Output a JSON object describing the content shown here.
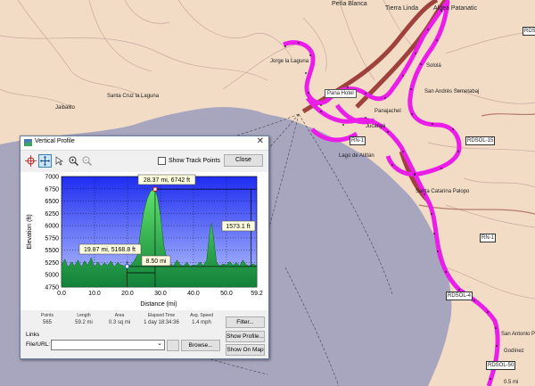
{
  "map": {
    "place_labels": [
      "Peña Blanca",
      "Tierra Linda",
      "Aldea Patanatic",
      "Jorge la Laguna",
      "Santa Cruz la Laguna",
      "Jaibalito",
      "Pana Hotel",
      "Jucanyá",
      "Lago de Atitlán",
      "Sololá",
      "San Andrés Semetabaj",
      "Santa Catarina Palopo",
      "San Antonio Palopo",
      "Godínez",
      "Panajachel"
    ],
    "road_labels": [
      "RDSOL-15",
      "RN-1",
      "RDSOL-1",
      "RDSOL-4",
      "RN-1",
      "RDSOL-50"
    ],
    "scale": "0.5 mi"
  },
  "dialog": {
    "title": "Vertical Profile",
    "show_track_points": "Show Track Points",
    "close": "Close",
    "toolbar_icons": [
      "crosshair-icon",
      "move-icon",
      "select-icon",
      "zoom-in-icon",
      "zoom-out-icon"
    ]
  },
  "chart_data": {
    "type": "area",
    "xlabel": "Distance  (mi)",
    "ylabel": "Elevation (ft)",
    "xlim": [
      0,
      59.2
    ],
    "ylim": [
      4750,
      7000
    ],
    "x_ticks": [
      "0.0",
      "10.0",
      "20.0",
      "30.0",
      "40.0",
      "50.0",
      "59.2"
    ],
    "y_ticks": [
      "4750",
      "5000",
      "5250",
      "5500",
      "5750",
      "6000",
      "6250",
      "6500",
      "6750",
      "7000"
    ],
    "x": [
      0,
      1,
      2,
      3,
      4,
      5,
      6,
      7,
      8,
      9,
      10,
      11,
      12,
      13,
      14,
      15,
      16,
      17,
      18,
      19,
      20,
      21,
      22,
      23,
      24,
      25,
      26,
      27,
      28,
      28.4,
      29,
      30,
      31,
      32,
      33,
      34,
      35,
      36,
      37,
      38,
      39,
      40,
      41,
      42,
      43,
      44,
      45,
      45.5,
      46,
      47,
      48,
      49,
      50,
      51,
      52,
      53,
      54,
      55,
      56,
      57,
      58,
      59.2
    ],
    "y": [
      5180,
      5320,
      5150,
      5260,
      5180,
      5300,
      5160,
      5280,
      5190,
      5350,
      5150,
      5260,
      5170,
      5240,
      5190,
      5280,
      5160,
      5250,
      5200,
      5180,
      5169,
      5200,
      5280,
      5400,
      5900,
      6300,
      6550,
      6700,
      6742,
      6720,
      6600,
      6200,
      5600,
      5300,
      5220,
      5180,
      5300,
      5200,
      5180,
      5250,
      5170,
      5200,
      5190,
      5260,
      5180,
      5300,
      5900,
      6050,
      5800,
      5250,
      5180,
      5220,
      5200,
      5270,
      5190,
      5250,
      5180,
      5300,
      5200,
      5180,
      5220,
      5180
    ],
    "annotations": [
      "28.37 mi, 6742 ft",
      "19.87 mi, 5168.8 ft",
      "8.50 mi",
      "1573.1 ft"
    ]
  },
  "stats": {
    "headers": [
      "Points",
      "Length",
      "Area",
      "Elapsed Time",
      "Avg. Speed"
    ],
    "values": [
      "565",
      "59.2 mi",
      "0.3 sq mi",
      "1 day 18:34:36",
      "1.4 mph"
    ]
  },
  "links": {
    "label": "Links",
    "file_url_label": "File/URL:",
    "browse": "Browse...",
    "filter": "Filter...",
    "show_profile": "Show Profile...",
    "show_on_map": "Show On Map"
  }
}
